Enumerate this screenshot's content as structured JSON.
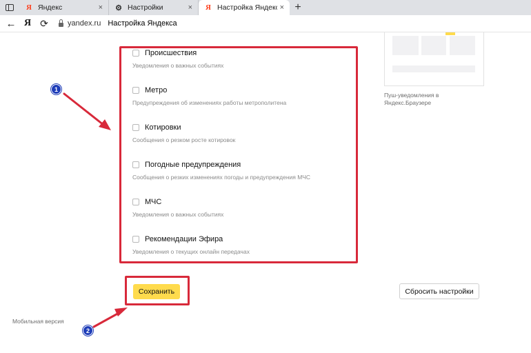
{
  "browser": {
    "tabs": [
      {
        "title": "Яндекс",
        "favicon": "yandex-icon",
        "close": "×"
      },
      {
        "title": "Настройки",
        "favicon": "gear-icon",
        "close": "×"
      },
      {
        "title": "Настройка Яндекса",
        "favicon": "yandex-icon",
        "close": "×"
      }
    ],
    "new_tab_symbol": "+",
    "nav": {
      "back": "←",
      "home_logo": "Я",
      "reload": "⟳"
    },
    "url": "yandex.ru",
    "page_title": "Настройка Яндекса"
  },
  "settings": [
    {
      "label": "Происшествия",
      "description": "Уведомления о важных событиях",
      "checked": false
    },
    {
      "label": "Метро",
      "description": "Предупреждения об изменениях работы метрополитена",
      "checked": false
    },
    {
      "label": "Котировки",
      "description": "Сообщения о резком росте котировок",
      "checked": false
    },
    {
      "label": "Погодные предупреждения",
      "description": "Сообщения о резких изменениях погоды и предупреждения МЧС",
      "checked": false
    },
    {
      "label": "МЧС",
      "description": "Уведомления о важных событиях",
      "checked": false
    },
    {
      "label": "Рекомендации Эфира",
      "description": "Уведомления о текущих онлайн передачах",
      "checked": false
    }
  ],
  "preview": {
    "caption": "Пуш-уведомления в Яндекс.Браузере"
  },
  "actions": {
    "save_label": "Сохранить",
    "reset_label": "Сбросить настройки"
  },
  "footer": {
    "mobile_link": "Мобильная версия"
  },
  "annotations": {
    "badge_1": "1",
    "badge_2": "2"
  },
  "colors": {
    "accent_yellow": "#ffdb4d",
    "highlight_red": "#d8293a",
    "badge_blue": "#1e3db8",
    "yandex_red": "#fc3f1d"
  }
}
